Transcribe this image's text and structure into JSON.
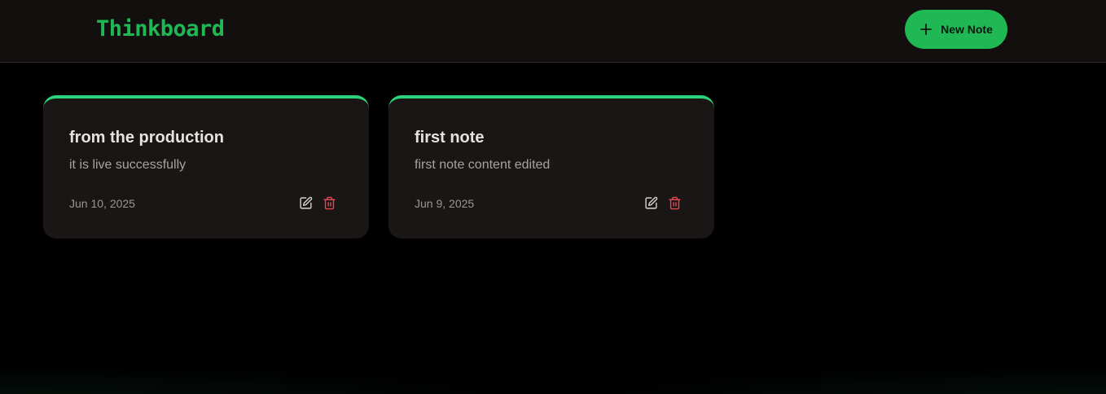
{
  "app": {
    "brand": "Thinkboard"
  },
  "header": {
    "new_note_label": "New Note",
    "new_note_icon": "plus-icon"
  },
  "notes": [
    {
      "title": "from the production",
      "content": "it is live successfully",
      "date": "Jun 10, 2025",
      "edit_icon": "edit-icon",
      "delete_icon": "trash-icon"
    },
    {
      "title": "first note",
      "content": "first note content edited",
      "date": "Jun 9, 2025",
      "edit_icon": "edit-icon",
      "delete_icon": "trash-icon"
    }
  ],
  "colors": {
    "accent": "#1fb854",
    "card_top_border": "#2bd47a",
    "delete": "#e8454f",
    "background": "#000000",
    "header_bg": "#120f0e",
    "card_bg": "#191615"
  }
}
